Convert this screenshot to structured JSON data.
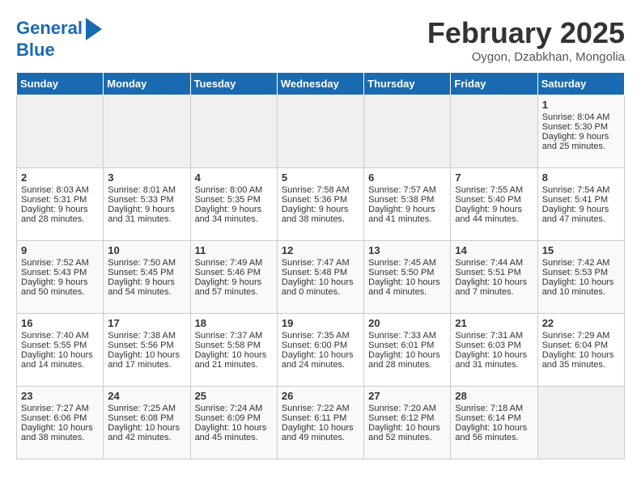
{
  "header": {
    "logo_line1": "General",
    "logo_line2": "Blue",
    "month": "February 2025",
    "location": "Oygon, Dzabkhan, Mongolia"
  },
  "weekdays": [
    "Sunday",
    "Monday",
    "Tuesday",
    "Wednesday",
    "Thursday",
    "Friday",
    "Saturday"
  ],
  "weeks": [
    [
      {
        "day": "",
        "content": ""
      },
      {
        "day": "",
        "content": ""
      },
      {
        "day": "",
        "content": ""
      },
      {
        "day": "",
        "content": ""
      },
      {
        "day": "",
        "content": ""
      },
      {
        "day": "",
        "content": ""
      },
      {
        "day": "1",
        "content": "Sunrise: 8:04 AM\nSunset: 5:30 PM\nDaylight: 9 hours and 25 minutes."
      }
    ],
    [
      {
        "day": "2",
        "content": "Sunrise: 8:03 AM\nSunset: 5:31 PM\nDaylight: 9 hours and 28 minutes."
      },
      {
        "day": "3",
        "content": "Sunrise: 8:01 AM\nSunset: 5:33 PM\nDaylight: 9 hours and 31 minutes."
      },
      {
        "day": "4",
        "content": "Sunrise: 8:00 AM\nSunset: 5:35 PM\nDaylight: 9 hours and 34 minutes."
      },
      {
        "day": "5",
        "content": "Sunrise: 7:58 AM\nSunset: 5:36 PM\nDaylight: 9 hours and 38 minutes."
      },
      {
        "day": "6",
        "content": "Sunrise: 7:57 AM\nSunset: 5:38 PM\nDaylight: 9 hours and 41 minutes."
      },
      {
        "day": "7",
        "content": "Sunrise: 7:55 AM\nSunset: 5:40 PM\nDaylight: 9 hours and 44 minutes."
      },
      {
        "day": "8",
        "content": "Sunrise: 7:54 AM\nSunset: 5:41 PM\nDaylight: 9 hours and 47 minutes."
      }
    ],
    [
      {
        "day": "9",
        "content": "Sunrise: 7:52 AM\nSunset: 5:43 PM\nDaylight: 9 hours and 50 minutes."
      },
      {
        "day": "10",
        "content": "Sunrise: 7:50 AM\nSunset: 5:45 PM\nDaylight: 9 hours and 54 minutes."
      },
      {
        "day": "11",
        "content": "Sunrise: 7:49 AM\nSunset: 5:46 PM\nDaylight: 9 hours and 57 minutes."
      },
      {
        "day": "12",
        "content": "Sunrise: 7:47 AM\nSunset: 5:48 PM\nDaylight: 10 hours and 0 minutes."
      },
      {
        "day": "13",
        "content": "Sunrise: 7:45 AM\nSunset: 5:50 PM\nDaylight: 10 hours and 4 minutes."
      },
      {
        "day": "14",
        "content": "Sunrise: 7:44 AM\nSunset: 5:51 PM\nDaylight: 10 hours and 7 minutes."
      },
      {
        "day": "15",
        "content": "Sunrise: 7:42 AM\nSunset: 5:53 PM\nDaylight: 10 hours and 10 minutes."
      }
    ],
    [
      {
        "day": "16",
        "content": "Sunrise: 7:40 AM\nSunset: 5:55 PM\nDaylight: 10 hours and 14 minutes."
      },
      {
        "day": "17",
        "content": "Sunrise: 7:38 AM\nSunset: 5:56 PM\nDaylight: 10 hours and 17 minutes."
      },
      {
        "day": "18",
        "content": "Sunrise: 7:37 AM\nSunset: 5:58 PM\nDaylight: 10 hours and 21 minutes."
      },
      {
        "day": "19",
        "content": "Sunrise: 7:35 AM\nSunset: 6:00 PM\nDaylight: 10 hours and 24 minutes."
      },
      {
        "day": "20",
        "content": "Sunrise: 7:33 AM\nSunset: 6:01 PM\nDaylight: 10 hours and 28 minutes."
      },
      {
        "day": "21",
        "content": "Sunrise: 7:31 AM\nSunset: 6:03 PM\nDaylight: 10 hours and 31 minutes."
      },
      {
        "day": "22",
        "content": "Sunrise: 7:29 AM\nSunset: 6:04 PM\nDaylight: 10 hours and 35 minutes."
      }
    ],
    [
      {
        "day": "23",
        "content": "Sunrise: 7:27 AM\nSunset: 6:06 PM\nDaylight: 10 hours and 38 minutes."
      },
      {
        "day": "24",
        "content": "Sunrise: 7:25 AM\nSunset: 6:08 PM\nDaylight: 10 hours and 42 minutes."
      },
      {
        "day": "25",
        "content": "Sunrise: 7:24 AM\nSunset: 6:09 PM\nDaylight: 10 hours and 45 minutes."
      },
      {
        "day": "26",
        "content": "Sunrise: 7:22 AM\nSunset: 6:11 PM\nDaylight: 10 hours and 49 minutes."
      },
      {
        "day": "27",
        "content": "Sunrise: 7:20 AM\nSunset: 6:12 PM\nDaylight: 10 hours and 52 minutes."
      },
      {
        "day": "28",
        "content": "Sunrise: 7:18 AM\nSunset: 6:14 PM\nDaylight: 10 hours and 56 minutes."
      },
      {
        "day": "",
        "content": ""
      }
    ]
  ]
}
